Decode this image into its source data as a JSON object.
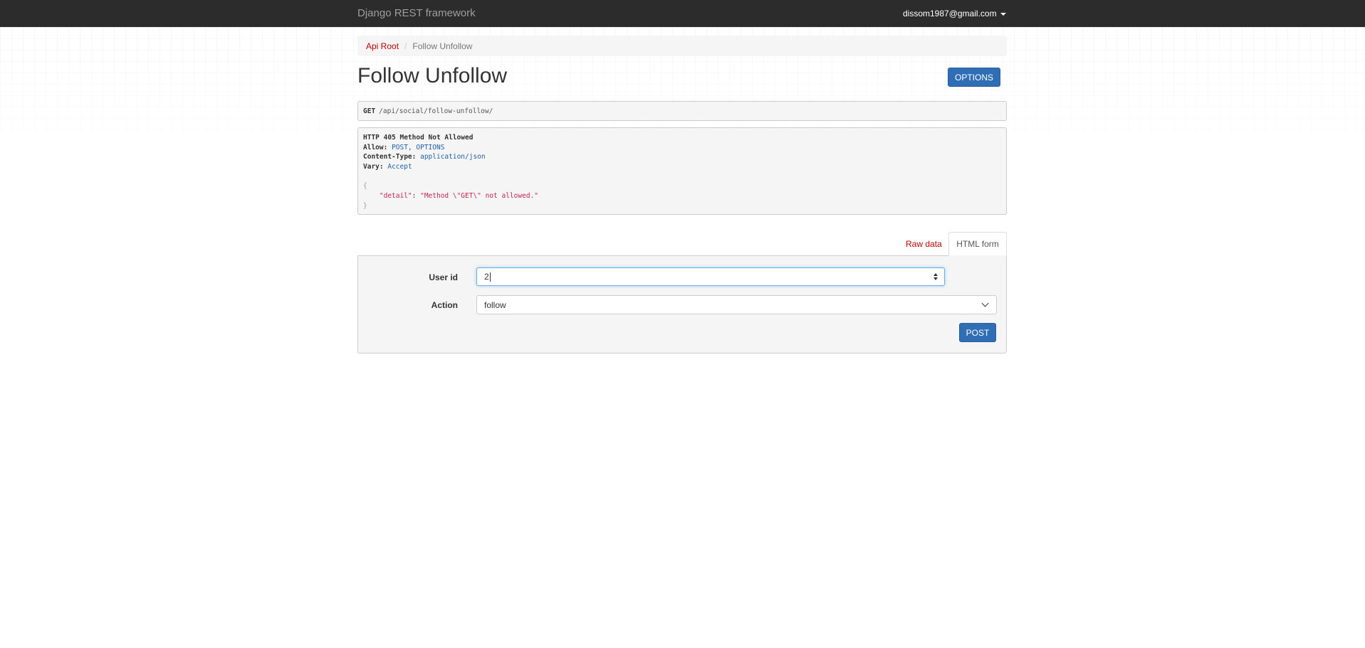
{
  "navbar": {
    "brand": "Django REST framework",
    "user": "dissom1987@gmail.com"
  },
  "breadcrumb": {
    "root": "Api Root",
    "current": "Follow Unfollow"
  },
  "page": {
    "title": "Follow Unfollow",
    "options_label": "OPTIONS"
  },
  "request": {
    "method": "GET",
    "url": "/api/social/follow-unfollow/"
  },
  "response": {
    "status": "HTTP 405 Method Not Allowed",
    "headers": [
      {
        "name": "Allow:",
        "value": "POST, OPTIONS"
      },
      {
        "name": "Content-Type:",
        "value": "application/json"
      },
      {
        "name": "Vary:",
        "value": "Accept"
      }
    ],
    "body_open": "{",
    "body_key": "\"detail\"",
    "body_colon": ": ",
    "body_value": "\"Method \\\"GET\\\" not allowed.\"",
    "body_close": "}"
  },
  "tabs": {
    "raw": "Raw data",
    "html": "HTML form"
  },
  "form": {
    "user_id_label": "User id",
    "user_id_value": "2",
    "action_label": "Action",
    "action_value": "follow",
    "submit_label": "POST"
  },
  "colors": {
    "navbar": "#2c2c2c",
    "link": "#c20000",
    "primary_button": "#2f6eb5",
    "header_value": "#1f5fa8",
    "json_string": "#c7254e"
  }
}
